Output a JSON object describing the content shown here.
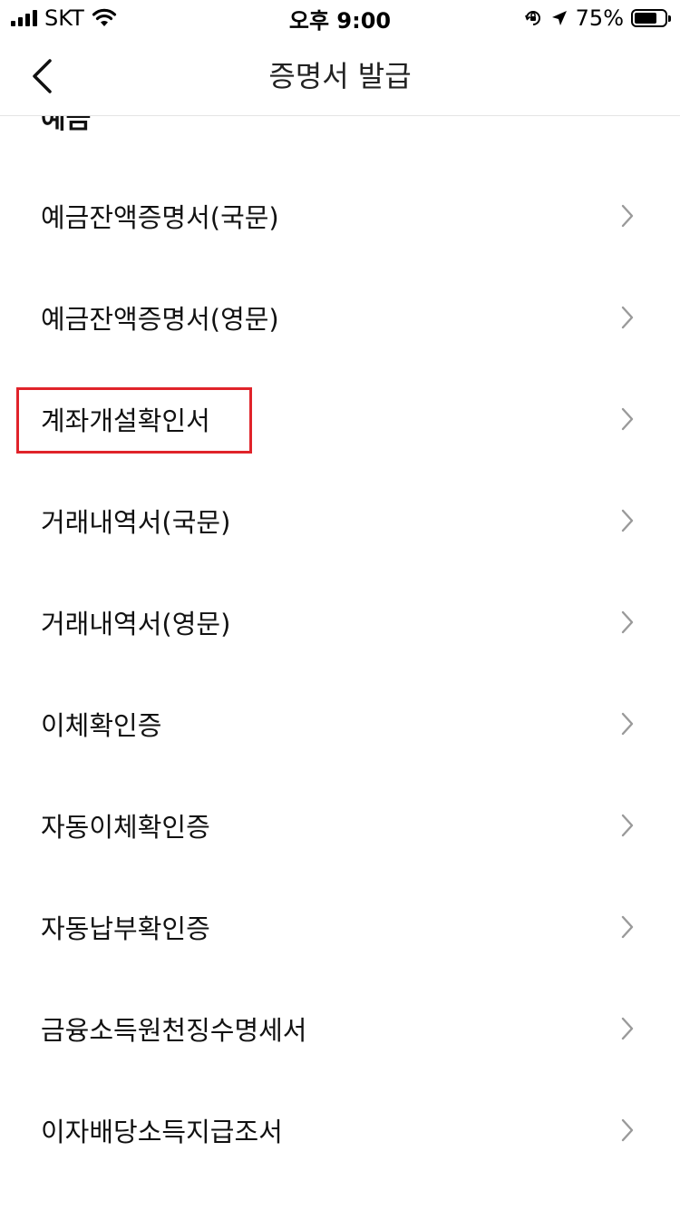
{
  "status_bar": {
    "carrier": "SKT",
    "time": "오후 9:00",
    "battery_percent": "75%",
    "battery_level": 0.75,
    "icons": [
      "cellular-signal-icon",
      "wifi-icon",
      "rotation-lock-icon",
      "location-arrow-icon",
      "battery-icon"
    ]
  },
  "nav": {
    "title": "증명서 발급",
    "back_icon": "chevron-left-icon"
  },
  "section": {
    "header": "예금"
  },
  "items": [
    {
      "label": "예금잔액증명서(국문)"
    },
    {
      "label": "예금잔액증명서(영문)"
    },
    {
      "label": "계좌개설확인서",
      "highlighted": true
    },
    {
      "label": "거래내역서(국문)"
    },
    {
      "label": "거래내역서(영문)"
    },
    {
      "label": "이체확인증"
    },
    {
      "label": "자동이체확인증"
    },
    {
      "label": "자동납부확인증"
    },
    {
      "label": "금융소득원천징수명세서"
    },
    {
      "label": "이자배당소득지급조서"
    }
  ],
  "colors": {
    "highlight": "#e0232a",
    "chevron": "#9a9a9a",
    "divider": "#e4e4e4"
  }
}
